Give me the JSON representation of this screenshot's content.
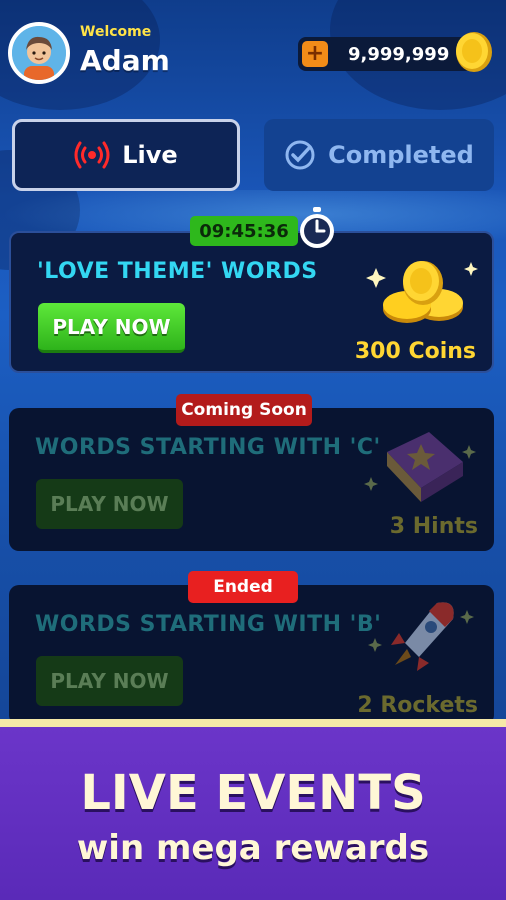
{
  "header": {
    "welcome_label": "Welcome",
    "username": "Adam",
    "coin_balance": "9,999,999",
    "add_coins_symbol": "+"
  },
  "tabs": [
    {
      "label": "Live",
      "icon": "live-broadcast-icon",
      "active": true
    },
    {
      "label": "Completed",
      "icon": "check-circle-icon",
      "active": false
    }
  ],
  "events": [
    {
      "timer": "09:45:36",
      "title": "'LOVE THEME' WORDS",
      "button_label": "PLAY NOW",
      "reward_label": "300 Coins",
      "reward_icon": "coins-icon",
      "state": "live"
    },
    {
      "status_badge": "Coming Soon",
      "title": "WORDS STARTING WITH 'C'",
      "button_label": "PLAY NOW",
      "reward_label": "3 Hints",
      "reward_icon": "hint-book-icon",
      "state": "coming-soon"
    },
    {
      "status_badge": "Ended",
      "title": "WORDS STARTING WITH 'B'",
      "button_label": "PLAY NOW",
      "reward_label": "2 Rockets",
      "reward_icon": "rocket-icon",
      "state": "ended"
    }
  ],
  "banner": {
    "title": "LIVE EVENTS",
    "subtitle": "win mega rewards"
  },
  "colors": {
    "accent_green": "#2eb31b",
    "title_cyan": "#33d7f2",
    "reward_gold": "#ffd633",
    "badge_red": "#e82020",
    "banner_purple": "#6b35c9"
  }
}
